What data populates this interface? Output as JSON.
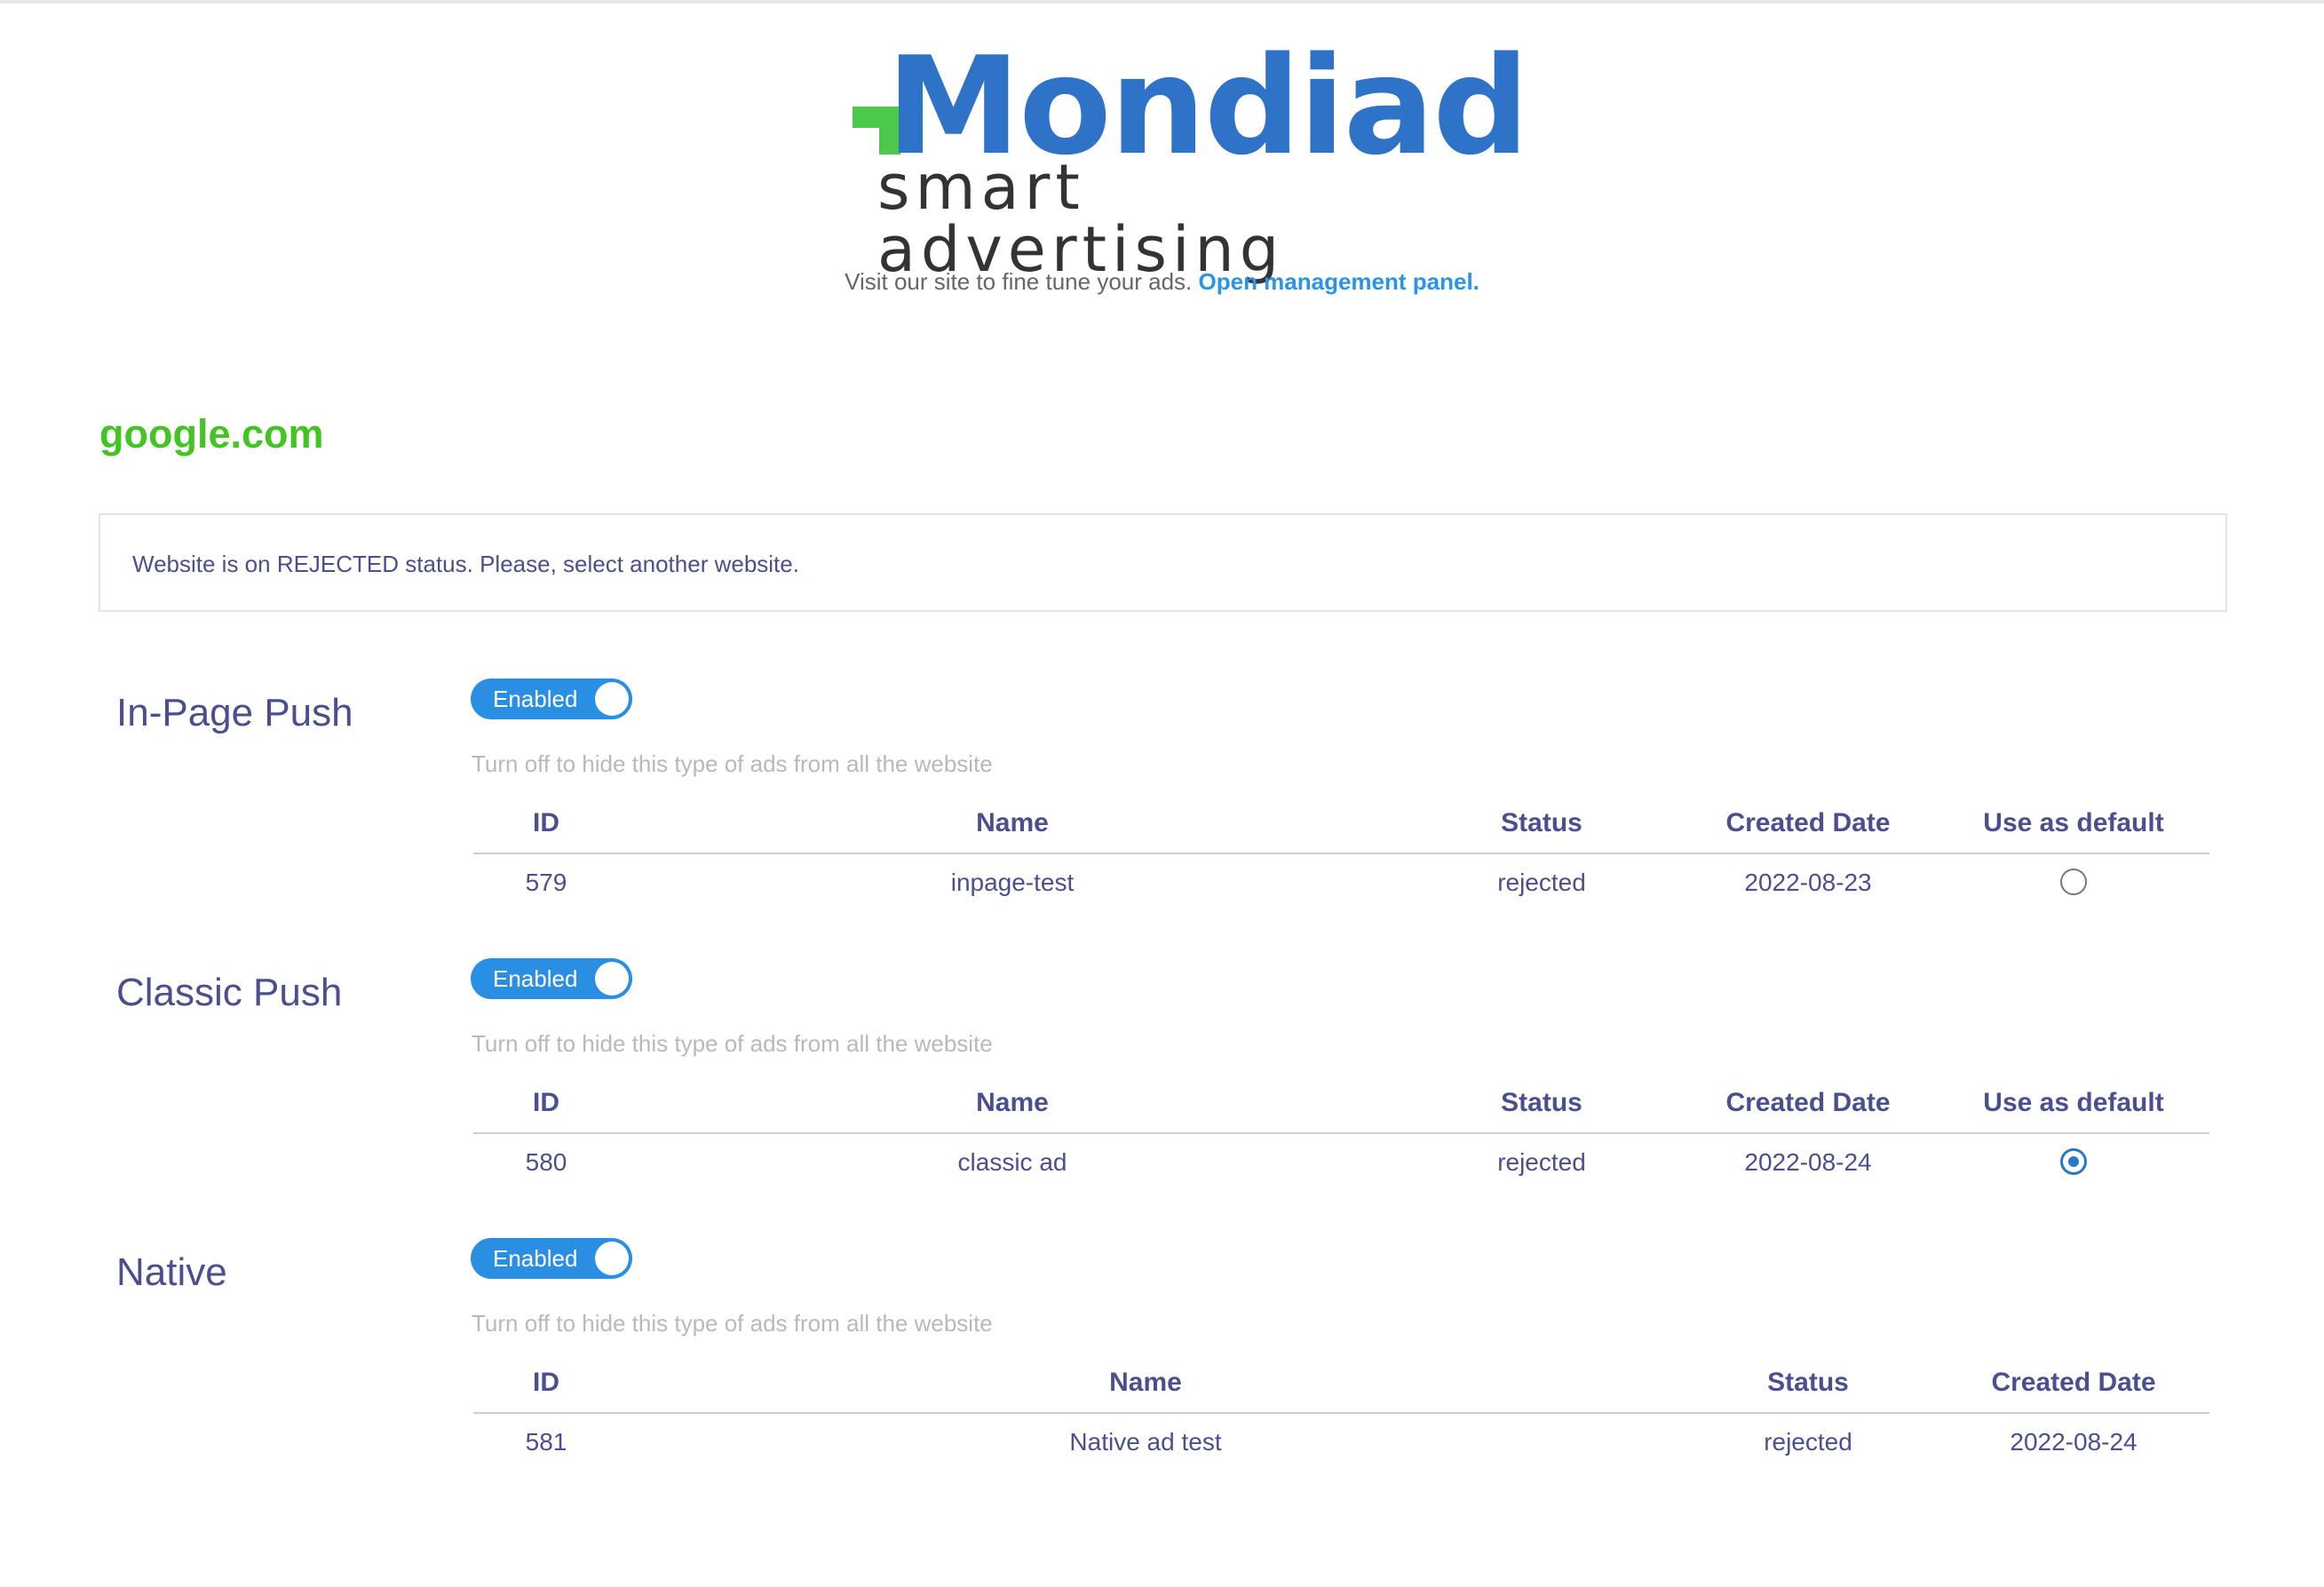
{
  "brand": {
    "logo_word": "Mondiad",
    "logo_tagline": "smart advertising",
    "logo_mark_color": "#4cc94a",
    "brand_color": "#2f73c9"
  },
  "header": {
    "tagline": "Visit our site to fine tune your ads.",
    "link_label": "Open management panel."
  },
  "site": {
    "domain": "google.com",
    "notice": "Website is on REJECTED status. Please, select another website."
  },
  "sections": [
    {
      "title": "In-Page Push",
      "toggle_label": "Enabled",
      "hint": "Turn off to hide this type of ads from all the website",
      "columns": [
        "ID",
        "Name",
        "Status",
        "Created Date",
        "Use as default"
      ],
      "rows": [
        {
          "id": "579",
          "name": "inpage-test",
          "status": "rejected",
          "created": "2022-08-23",
          "default": false
        }
      ]
    },
    {
      "title": "Classic Push",
      "toggle_label": "Enabled",
      "hint": "Turn off to hide this type of ads from all the website",
      "columns": [
        "ID",
        "Name",
        "Status",
        "Created Date",
        "Use as default"
      ],
      "rows": [
        {
          "id": "580",
          "name": "classic ad",
          "status": "rejected",
          "created": "2022-08-24",
          "default": true
        }
      ]
    },
    {
      "title": "Native",
      "toggle_label": "Enabled",
      "hint": "Turn off to hide this type of ads from all the website",
      "columns": [
        "ID",
        "Name",
        "Status",
        "Created Date"
      ],
      "rows": [
        {
          "id": "581",
          "name": "Native ad test",
          "status": "rejected",
          "created": "2022-08-24"
        }
      ]
    }
  ],
  "colors": {
    "domain_green": "#44c423",
    "toggle_blue": "#2a8fe3",
    "link_blue": "#2a94e8",
    "text_indigo": "#4b4f8e"
  }
}
